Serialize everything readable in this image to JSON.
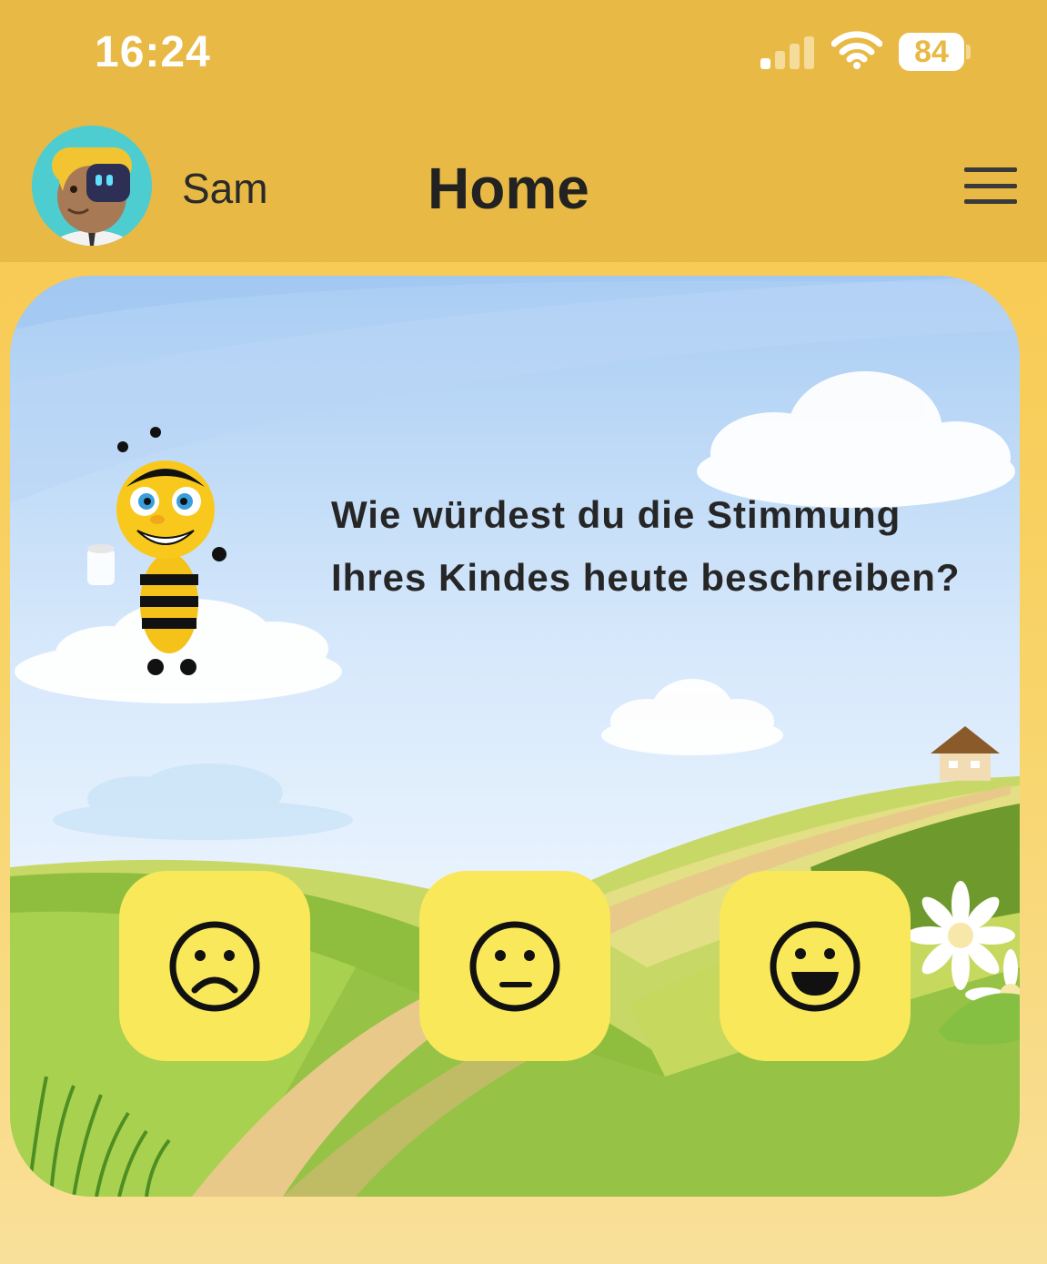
{
  "status_bar": {
    "time": "16:24",
    "battery": "84",
    "signal_icon": "cellular-signal-icon",
    "wifi_icon": "wifi-icon",
    "battery_icon": "battery-icon"
  },
  "header": {
    "user_name": "Sam",
    "title": "Home",
    "menu_icon": "hamburger-menu-icon",
    "avatar": "user-avatar"
  },
  "prompt": {
    "question": "Wie würdest du die Stimmung Ihres Kindes heute beschreiben?"
  },
  "moods": [
    {
      "name": "sad",
      "icon": "sad-face-icon"
    },
    {
      "name": "neutral",
      "icon": "neutral-face-icon"
    },
    {
      "name": "happy",
      "icon": "happy-face-icon"
    }
  ],
  "colors": {
    "header_bg": "#e8b944",
    "mood_button_bg": "#f9e85a",
    "text_dark": "#222222"
  }
}
